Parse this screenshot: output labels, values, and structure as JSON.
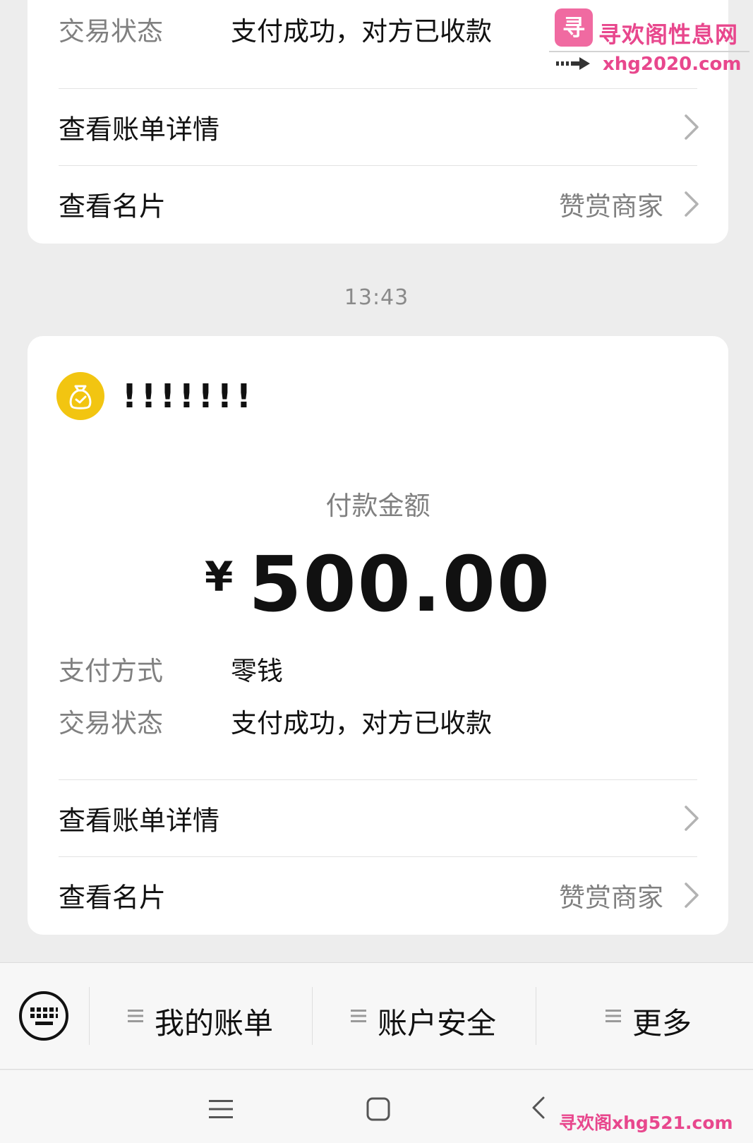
{
  "top_card": {
    "status_label": "交易状态",
    "status_value": "支付成功，对方已收款",
    "bill_details": "查看账单详情",
    "business_card": "查看名片",
    "reward_merchant": "赞赏商家"
  },
  "timestamp": "13:43",
  "payment_card": {
    "merchant_name": "!!!!!!!",
    "amount_label": "付款金额",
    "currency_symbol": "¥",
    "amount": "500.00",
    "method_label": "支付方式",
    "method_value": "零钱",
    "status_label": "交易状态",
    "status_value": "支付成功，对方已收款",
    "bill_details": "查看账单详情",
    "business_card": "查看名片",
    "reward_merchant": "赞赏商家"
  },
  "bottom_menu": {
    "items": [
      {
        "label": "我的账单"
      },
      {
        "label": "账户安全"
      },
      {
        "label": "更多"
      }
    ]
  },
  "watermark": {
    "logo_char": "寻",
    "site_name": "寻欢阁性息网",
    "domain_top": "xhg2020.com",
    "domain_bottom": "寻欢阁xhg521.com"
  },
  "colors": {
    "background": "#ededed",
    "card": "#ffffff",
    "merchant_icon": "#f2c511",
    "secondary_text": "#808080",
    "watermark": "#e8478d"
  }
}
